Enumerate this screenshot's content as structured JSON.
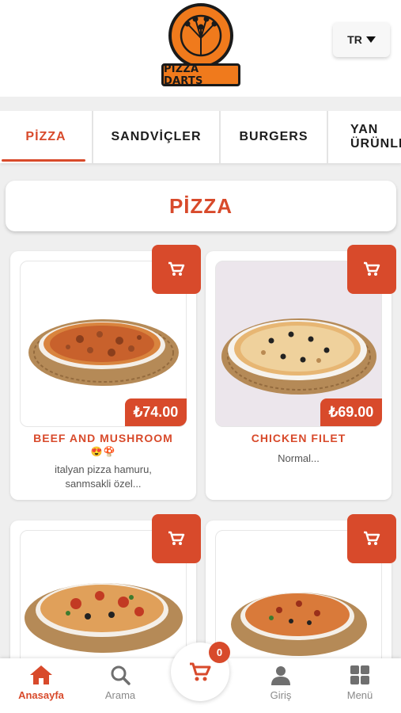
{
  "header": {
    "logo_text": "PIZZA DARTS",
    "language": "TR"
  },
  "tabs": [
    {
      "label": "PİZZA",
      "active": true
    },
    {
      "label": "SANDVİÇLER",
      "active": false
    },
    {
      "label": "BURGERS",
      "active": false
    },
    {
      "label": "YAN ÜRÜNLER",
      "active": false
    }
  ],
  "section": {
    "title": "PİZZA"
  },
  "products": [
    {
      "name": "BEEF AND MUSHROOM",
      "emoji": "😍🍄",
      "description_line1": "italyan pizza hamuru,",
      "description_line2": "sanmsakli özel...",
      "price": "₺74.00"
    },
    {
      "name": "CHICKEN FILET",
      "description_line1": "Normal...",
      "price": "₺69.00"
    },
    {
      "name": "",
      "price": ""
    },
    {
      "name": "",
      "price": ""
    }
  ],
  "cart": {
    "count": "0"
  },
  "bottom_nav": [
    {
      "label": "Anasayfa",
      "icon": "home-icon",
      "active": true
    },
    {
      "label": "Arama",
      "icon": "search-icon",
      "active": false
    },
    {
      "label": "Giriş",
      "icon": "user-icon",
      "active": false
    },
    {
      "label": "Menü",
      "icon": "grid-icon",
      "active": false
    }
  ],
  "colors": {
    "accent": "#d84a2b",
    "logo_orange": "#f07a1c",
    "background": "#efefef"
  }
}
